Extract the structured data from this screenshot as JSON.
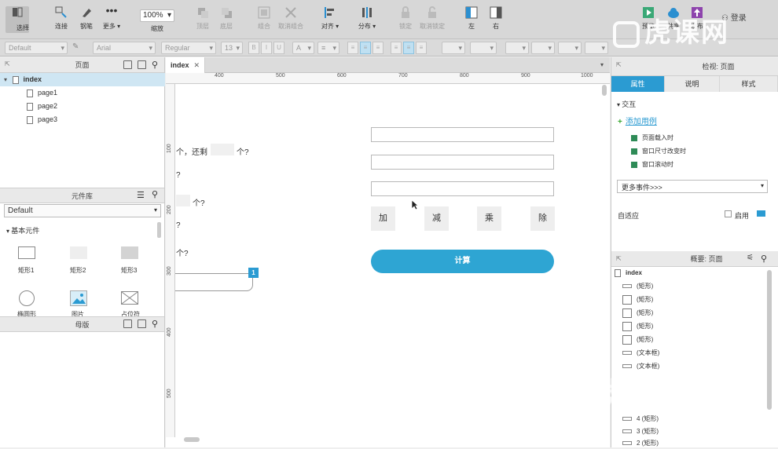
{
  "toolbar": {
    "select": "选择",
    "connect": "连接",
    "pen": "钢笔",
    "more": "更多 ▾",
    "zoom": "100%",
    "zoom_label": "缩放",
    "top": "顶层",
    "bottom": "底层",
    "group": "组合",
    "ungroup": "取消组合",
    "align": "对齐 ▾",
    "distribute": "分布 ▾",
    "lock": "锁定",
    "unlock": "取消锁定",
    "left": "左",
    "right": "右",
    "preview": "预览",
    "share": "共享",
    "publish": "发布",
    "login": "登录"
  },
  "format": {
    "style": "Default",
    "font": "Arial",
    "weight": "Regular",
    "size": "13"
  },
  "pages": {
    "title": "页面",
    "root": "index",
    "items": [
      "page1",
      "page2",
      "page3"
    ]
  },
  "library": {
    "title": "元件库",
    "selected": "Default",
    "section": "基本元件",
    "widgets": [
      "矩形1",
      "矩形2",
      "矩形3",
      "椭圆形",
      "图片",
      "占位符"
    ]
  },
  "masters": {
    "title": "母版"
  },
  "canvas": {
    "tab": "index",
    "ruler_h": [
      "400",
      "500",
      "600",
      "700",
      "800",
      "900",
      "1000"
    ],
    "ruler_v": [
      "100",
      "200",
      "300",
      "400",
      "500"
    ],
    "text_lines": [
      "个，还剩",
      "个?",
      "?",
      "个?",
      "?",
      "个?"
    ],
    "badge": "1",
    "ops": [
      "加",
      "减",
      "乘",
      "除"
    ],
    "calc": "计算"
  },
  "inspector": {
    "title": "检视: 页面",
    "tabs": [
      "属性",
      "说明",
      "样式"
    ],
    "interaction": "交互",
    "add_case": "添加用例",
    "events": [
      "页面载入时",
      "窗口尺寸改变时",
      "窗口滚动时"
    ],
    "more_events": "更多事件>>>",
    "adaptive": "自适应",
    "enable": "启用"
  },
  "outline": {
    "title": "概要: 页面",
    "root": "index",
    "items": [
      "(矩形)",
      "(矩形)",
      "(矩形)",
      "(矩形)",
      "(矩形)",
      "(文本框)",
      "(文本框)"
    ],
    "bottom_items": [
      "4 (矩形)",
      "3 (矩形)",
      "2 (矩形)"
    ]
  },
  "watermark": "虎课网"
}
